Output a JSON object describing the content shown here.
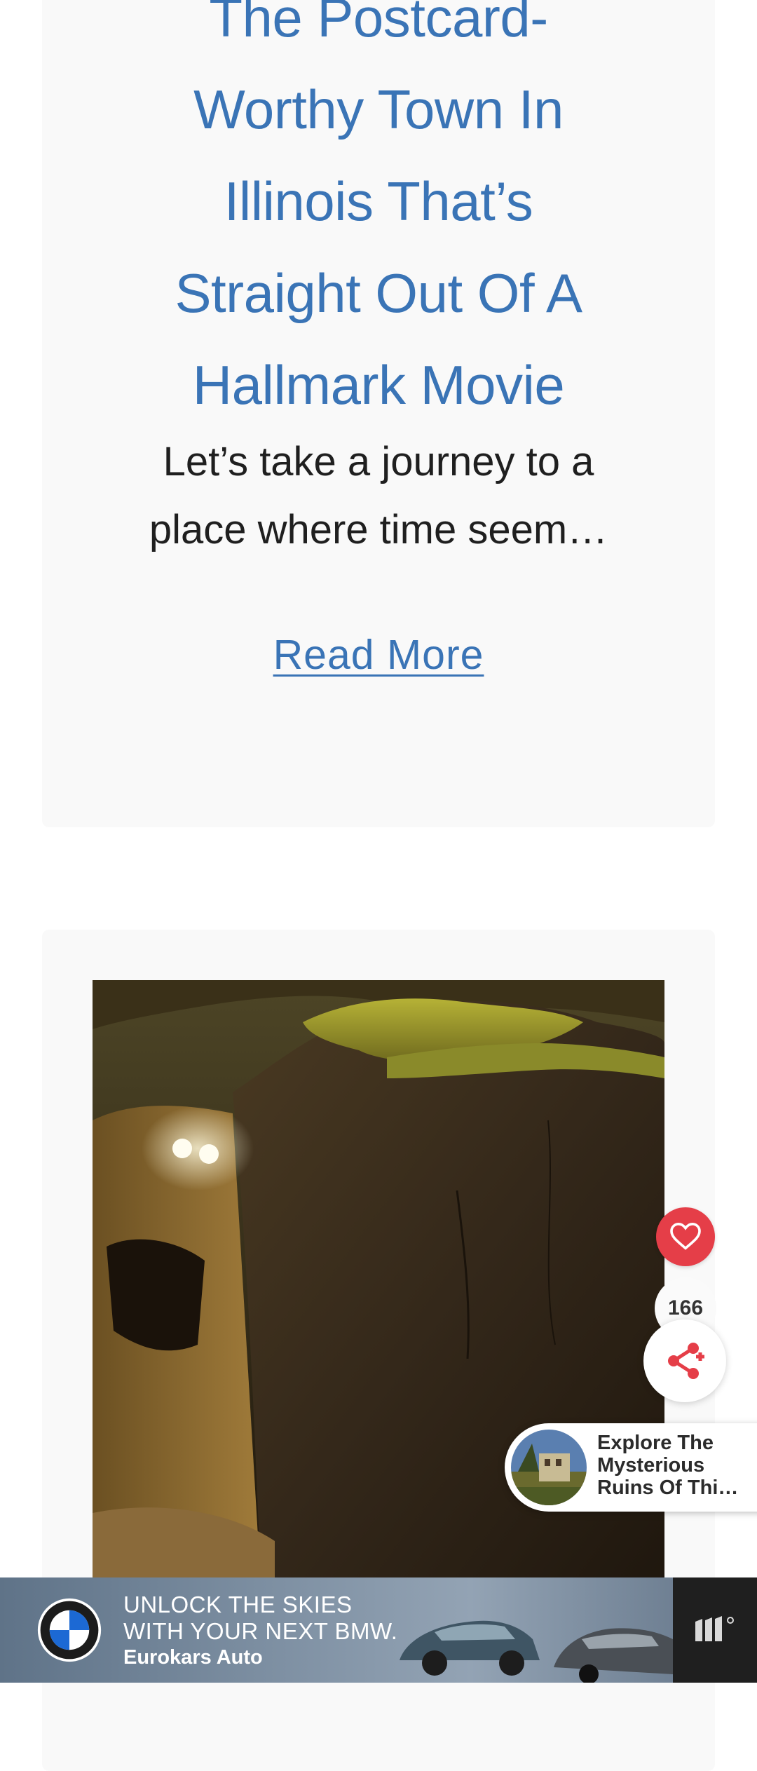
{
  "article1": {
    "title_lines": [
      "The Postcard-",
      "Worthy Town In",
      "Illinois That’s",
      "Straight Out Of A",
      "Hallmark Movie"
    ],
    "excerpt_lines": [
      "Let’s take a journey to a",
      "place where time seem…"
    ],
    "read_more": "Read More"
  },
  "article2": {
    "image_icon": "cave-photo"
  },
  "floating_actions": {
    "like_icon": "heart-icon",
    "like_count": "166",
    "share_icon": "share-icon"
  },
  "recommendation": {
    "title_lines": [
      "Explore The",
      "Mysterious",
      "Ruins Of Thi…"
    ]
  },
  "ad": {
    "line1": "UNLOCK THE SKIES",
    "line2": "WITH YOUR NEXT BMW.",
    "line3": "Eurokars Auto",
    "brand_icon": "bmw-logo-icon",
    "side_icon": "ad-network-logo-icon"
  },
  "colors": {
    "link": "#3a74b6",
    "like": "#e53e48",
    "share": "#e53e48",
    "card_bg": "#f9f9f9"
  }
}
